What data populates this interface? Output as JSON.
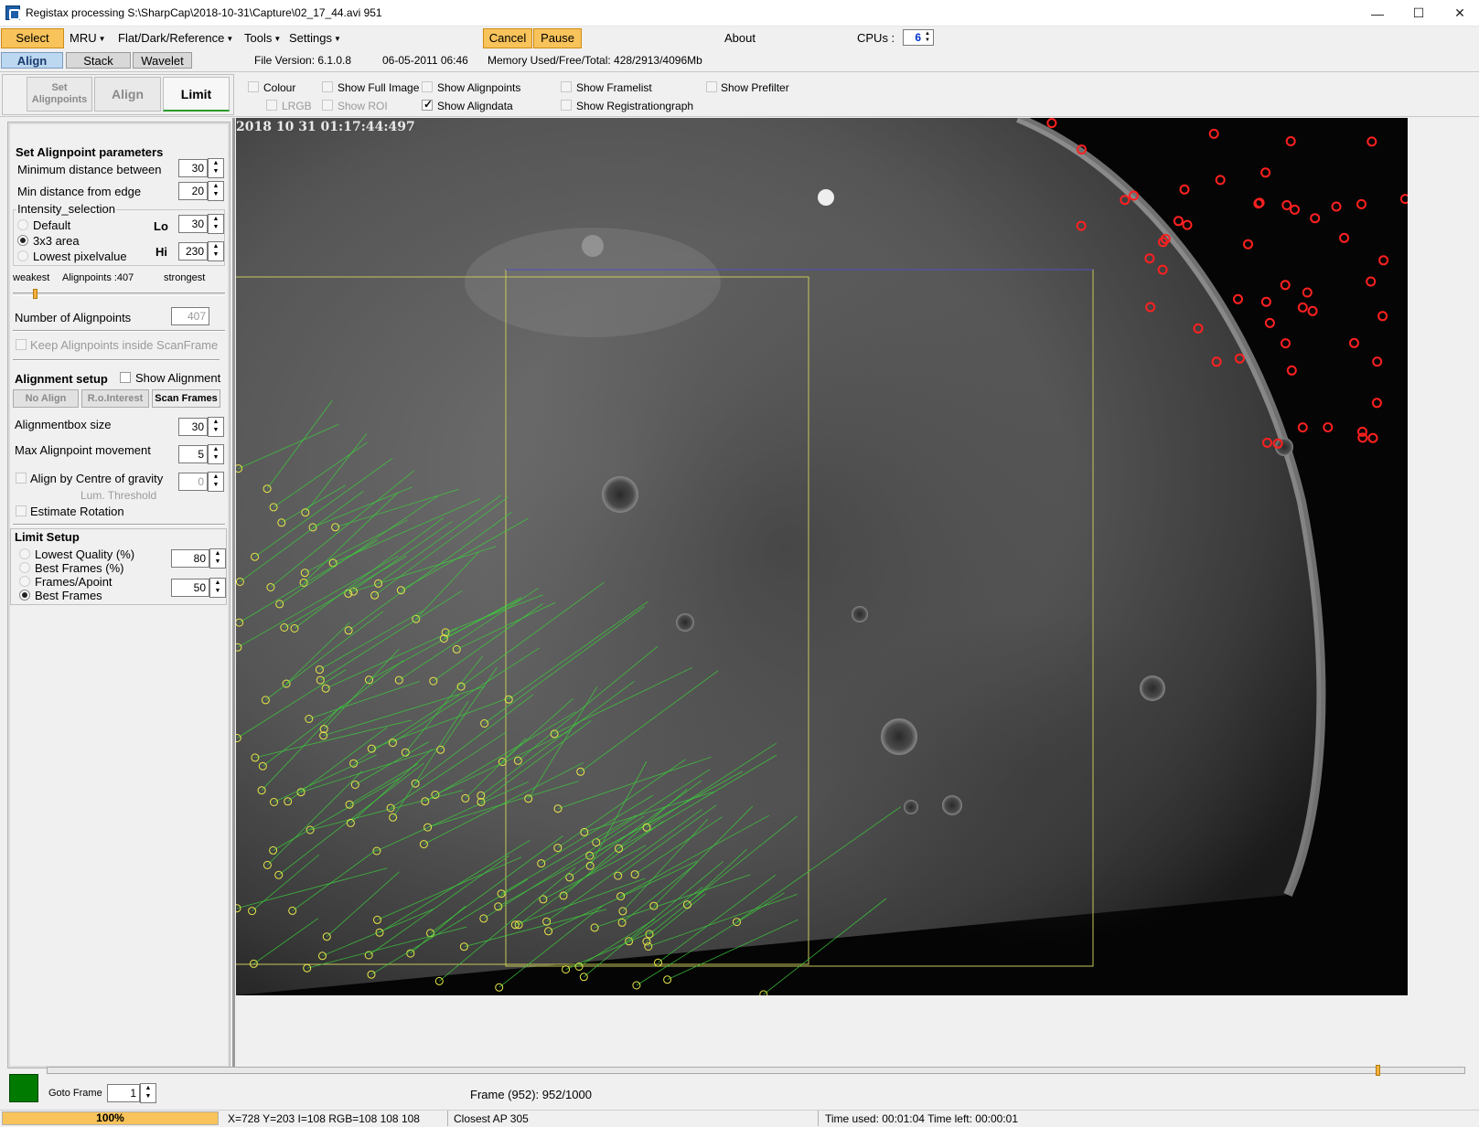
{
  "window": {
    "title": "Registax processing S:\\SharpCap\\2018-10-31\\Capture\\02_17_44.avi 951",
    "minimize": "—",
    "maximize": "☐",
    "close": "✕"
  },
  "menu": {
    "select": "Select",
    "mru": "MRU",
    "flat": "Flat/Dark/Reference",
    "tools": "Tools",
    "settings": "Settings",
    "cancel": "Cancel",
    "pause": "Pause",
    "about": "About",
    "cpus_label": "CPUs :",
    "cpus_value": "6"
  },
  "tabs": {
    "align": "Align",
    "stack": "Stack",
    "wavelet": "Wavelet"
  },
  "info": {
    "file_version": "File Version: 6.1.0.8",
    "date": "06-05-2011 06:46",
    "memory": "Memory Used/Free/Total: 428/2913/4096Mb"
  },
  "modes": {
    "set_alignpoints_1": "Set",
    "set_alignpoints_2": "Alignpoints",
    "align": "Align",
    "limit": "Limit"
  },
  "toggles": {
    "colour": "Colour",
    "lrgb": "LRGB",
    "show_full_image": "Show Full Image",
    "show_roi": "Show ROI",
    "show_alignpoints": "Show Alignpoints",
    "show_aligndata": "Show Aligndata",
    "show_framelist": "Show Framelist",
    "show_registrationgraph": "Show Registrationgraph",
    "show_prefilter": "Show Prefilter"
  },
  "panel": {
    "set_ap_title": "Set Alignpoint parameters",
    "min_distance": "Minimum distance between",
    "min_distance_val": "30",
    "min_edge": "Min distance from edge",
    "min_edge_val": "20",
    "intensity": "Intensity_selection",
    "default": "Default",
    "area": "3x3 area",
    "lowest": "Lowest pixelvalue",
    "lo": "Lo",
    "lo_val": "30",
    "hi": "Hi",
    "hi_val": "230",
    "weakest": "weakest",
    "alignpoints_count": "Alignpoints :407",
    "strongest": "strongest",
    "num_ap": "Number of Alignpoints",
    "num_ap_val": "407",
    "keep_inside": "Keep Alignpoints inside ScanFrame",
    "alignment_setup": "Alignment setup",
    "show_alignment": "Show Alignment",
    "no_align": "No Align",
    "ro_interest": "R.o.Interest",
    "scan_frames": "Scan Frames",
    "box_size": "Alignmentbox size",
    "box_size_val": "30",
    "max_move": "Max Alignpoint movement",
    "max_move_val": "5",
    "centre_gravity": "Align by Centre of gravity",
    "lum_threshold": "Lum. Threshold",
    "lum_val": "0",
    "estimate_rotation": "Estimate Rotation",
    "limit_setup": "Limit Setup",
    "lowest_quality": "Lowest Quality (%)",
    "lowest_quality_val": "80",
    "best_frames_pct": "Best Frames (%)",
    "frames_apoint": "Frames/Apoint",
    "best_frames": "Best Frames",
    "best_frames_val": "50"
  },
  "viewport": {
    "timestamp": "2018 10 31  01:17:44:497"
  },
  "bottom": {
    "goto_frame": "Goto Frame",
    "goto_val": "1",
    "frame_info": "Frame (952): 952/1000",
    "slider_position": 0.94
  },
  "status": {
    "progress": "100%",
    "progress_value": 1.0,
    "coords": "X=728 Y=203 I=108 RGB=108 108 108",
    "closest": "Closest AP 305",
    "time": "Time used: 00:01:04 Time left: 00:00:01"
  },
  "colors": {
    "select_bg": "#f8c35a",
    "ap_red": "#ff2020",
    "ap_yellow": "#e8e84a",
    "trace_green": "#3ccf3c",
    "frame_swatch": "#007a00"
  }
}
